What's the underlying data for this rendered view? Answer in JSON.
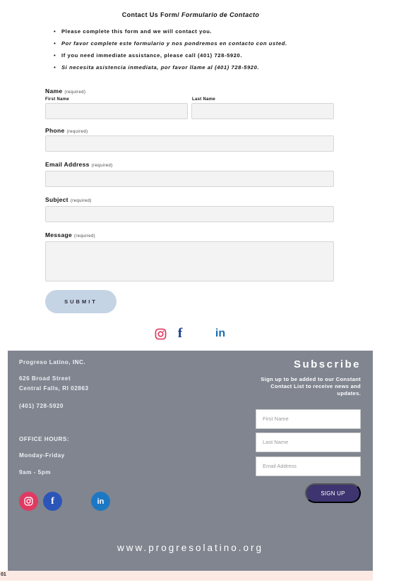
{
  "form": {
    "title_part1": "Contact Us Form/",
    "title_part2": "Formulario de Contacto",
    "bullets": [
      "Please complete this form and we will contact you.",
      "Por favor complete este formulario y nos pondremos en contacto con usted.",
      "If you need immediate assistance, please call (401) 728-5920.",
      "Si necesita asistencia inmediata, por favor llame al (401) 728-5920."
    ],
    "required_text": "(required)",
    "name_label": "Name",
    "first_name_label": "First Name",
    "last_name_label": "Last Name",
    "phone_label": "Phone",
    "email_label": "Email Address",
    "subject_label": "Subject",
    "message_label": "Message",
    "submit_label": "SUBMIT"
  },
  "social_icons": [
    "instagram-icon",
    "facebook-icon",
    "linkedin-icon"
  ],
  "footer": {
    "org_name": "Progreso Latino, INC.",
    "address_line1": "626 Broad Street",
    "address_line2": "Central Falls, RI 02863",
    "phone": "(401) 728-5920",
    "office_hours_label": "OFFICE HOURS:",
    "days": "Monday-Friday",
    "hours": "9am - 5pm",
    "subscribe_title": "Subscribe",
    "subscribe_text": "Sign up to be added to our Constant Contact List to receive news and updates.",
    "first_name_placeholder": "First Name",
    "last_name_placeholder": "Last Name",
    "email_placeholder": "Email Address",
    "signup_label": "SIGN UP",
    "website": "www.progresolatino.org"
  },
  "bottom_strip": {
    "text": "01"
  },
  "colors": {
    "footer_bg": "#808590",
    "submit_bg": "#c5d4e4",
    "signup_bg": "#3d3470",
    "instagram": "#e03a62",
    "facebook": "#2b55b8",
    "linkedin": "#1d78c4",
    "strip_bg": "#fde9e4"
  }
}
